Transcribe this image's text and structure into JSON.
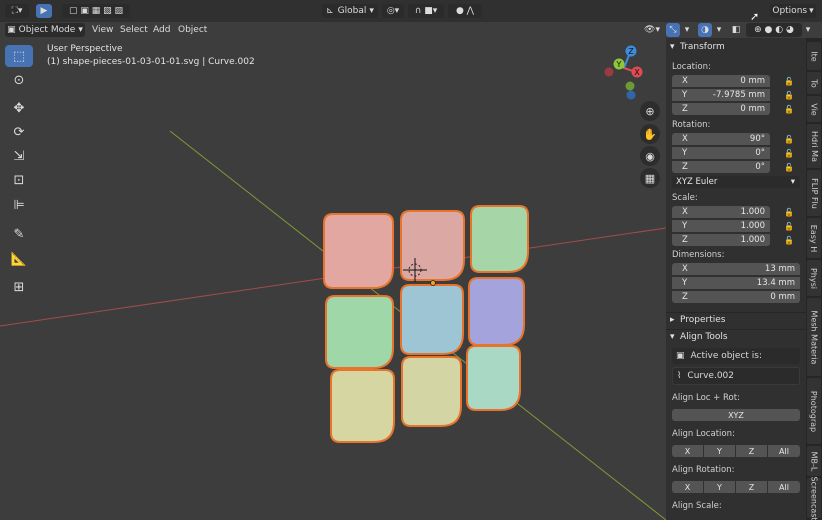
{
  "topbar": {
    "orientation": "Global",
    "options_label": "Options"
  },
  "header": {
    "mode": "Object Mode",
    "menus": [
      "View",
      "Select",
      "Add",
      "Object"
    ]
  },
  "viewport": {
    "perspective_label": "User Perspective",
    "object_label": "(1) shape-pieces-01-03-01-01.svg | Curve.002",
    "gizmo_axes": [
      "Z",
      "Y",
      "X"
    ]
  },
  "npanel": {
    "transform": {
      "title": "Transform",
      "location_label": "Location:",
      "location": [
        {
          "axis": "X",
          "value": "0 mm"
        },
        {
          "axis": "Y",
          "value": "-7.9785 mm"
        },
        {
          "axis": "Z",
          "value": "0 mm"
        }
      ],
      "rotation_label": "Rotation:",
      "rotation": [
        {
          "axis": "X",
          "value": "90°"
        },
        {
          "axis": "Y",
          "value": "0°"
        },
        {
          "axis": "Z",
          "value": "0°"
        }
      ],
      "rotation_mode": "XYZ Euler",
      "scale_label": "Scale:",
      "scale": [
        {
          "axis": "X",
          "value": "1.000"
        },
        {
          "axis": "Y",
          "value": "1.000"
        },
        {
          "axis": "Z",
          "value": "1.000"
        }
      ],
      "dimensions_label": "Dimensions:",
      "dimensions": [
        {
          "axis": "X",
          "value": "13 mm"
        },
        {
          "axis": "Y",
          "value": "13.4 mm"
        },
        {
          "axis": "Z",
          "value": "0 mm"
        }
      ]
    },
    "properties_title": "Properties",
    "align": {
      "title": "Align Tools",
      "active_label": "Active object is:",
      "active_object": "Curve.002",
      "loc_rot_label": "Align Loc + Rot:",
      "loc_rot_button": "XYZ",
      "location_label": "Align Location:",
      "rotation_label": "Align Rotation:",
      "scale_label": "Align Scale:",
      "axis_buttons": [
        "X",
        "Y",
        "Z",
        "All"
      ]
    }
  },
  "tabs": [
    "Ite",
    "To",
    "Vie",
    "Hdri Ma",
    "FLIP Flu",
    "Easy H",
    "Physi",
    "Mesh Materia",
    "Photograp",
    "MB-L",
    "Screencast"
  ],
  "tiles": [
    {
      "color": "#e1a7a0"
    },
    {
      "color": "#dca8a4"
    },
    {
      "color": "#a6d6a8"
    },
    {
      "color": "#9fd7a9"
    },
    {
      "color": "#9ec5d3"
    },
    {
      "color": "#a4a3dc"
    },
    {
      "color": "#d5d6a2"
    },
    {
      "color": "#d3d6a4"
    },
    {
      "color": "#a9d8c5"
    }
  ],
  "colors": {
    "accent": "#4772b3",
    "outline": "#e8742b",
    "x_axis": "#c25b5b",
    "y_axis": "#8bb43a",
    "gizmo_x": "#e04b54",
    "gizmo_y": "#8fc43b",
    "gizmo_z": "#3b8de0"
  }
}
